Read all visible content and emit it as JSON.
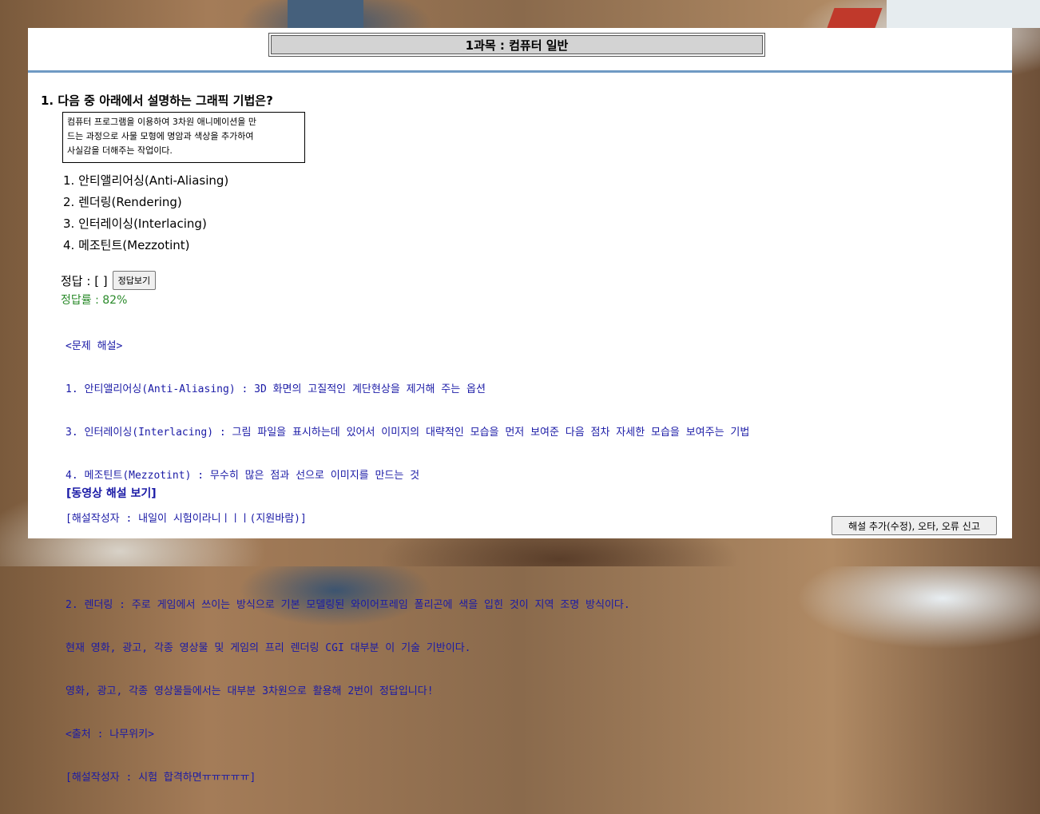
{
  "header": {
    "title": "1과목 : 컴퓨터 일반"
  },
  "question": {
    "text": "1. 다음 중 아래에서 설명하는 그래픽 기법은?",
    "passage_lines": [
      "컴퓨터 프로그램을 이용하여 3차원 애니메이션을 만",
      "드는 과정으로 사물 모형에 명암과 색상을 추가하여",
      "사실감을 더해주는 작업이다."
    ],
    "choices": [
      "1. 안티앨리어싱(Anti-Aliasing)",
      "2. 렌더링(Rendering)",
      "3. 인터레이싱(Interlacing)",
      "4. 메조틴트(Mezzotint)"
    ]
  },
  "answer": {
    "label": "정답 : [ ]",
    "button_label": "정답보기",
    "rate": "정답률 : 82%"
  },
  "explanation": {
    "lines": [
      "<문제 해설>",
      "1. 안티앨리어싱(Anti-Aliasing) : 3D 화면의 고질적인 계단현상을 제거해 주는 옵션",
      "3. 인터레이싱(Interlacing) : 그림 파일을 표시하는데 있어서 이미지의 대략적인 모습을 먼저 보여준 다음 점차 자세한 모습을 보여주는 기법",
      "4. 메조틴트(Mezzotint) : 무수히 많은 점과 선으로 이미지를 만드는 것",
      "[해설작성자 : 내일이 시험이라니ㅣㅣㅣ(지원바람)]",
      "",
      "2. 렌더링 : 주로 게임에서 쓰이는 방식으로 기본 모델링된 와이어프레임 폴리곤에 색을 입힌 것이 지역 조명 방식이다.",
      "현재 영화, 광고, 각종 영상물 및 게임의 프리 렌더링 CGI 대부분 이 기술 기반이다.",
      "영화, 광고, 각종 영상물들에서는 대부분 3차원으로 활용해 2번이 정답입니다!",
      "<출처 : 나무위키>",
      "[해설작성자 : 시험 합격하면ㅠㅠㅠㅠㅠ]"
    ],
    "video_link": "[동영상 해설 보기]",
    "report_button": "해설 추가(수정), 오타, 오류 신고"
  },
  "colors": {
    "explanation_text": "#1a1aa6",
    "rate_text": "#2a8a2a",
    "divider": "#6f9ac4",
    "title_bg": "#d3d3d3"
  }
}
